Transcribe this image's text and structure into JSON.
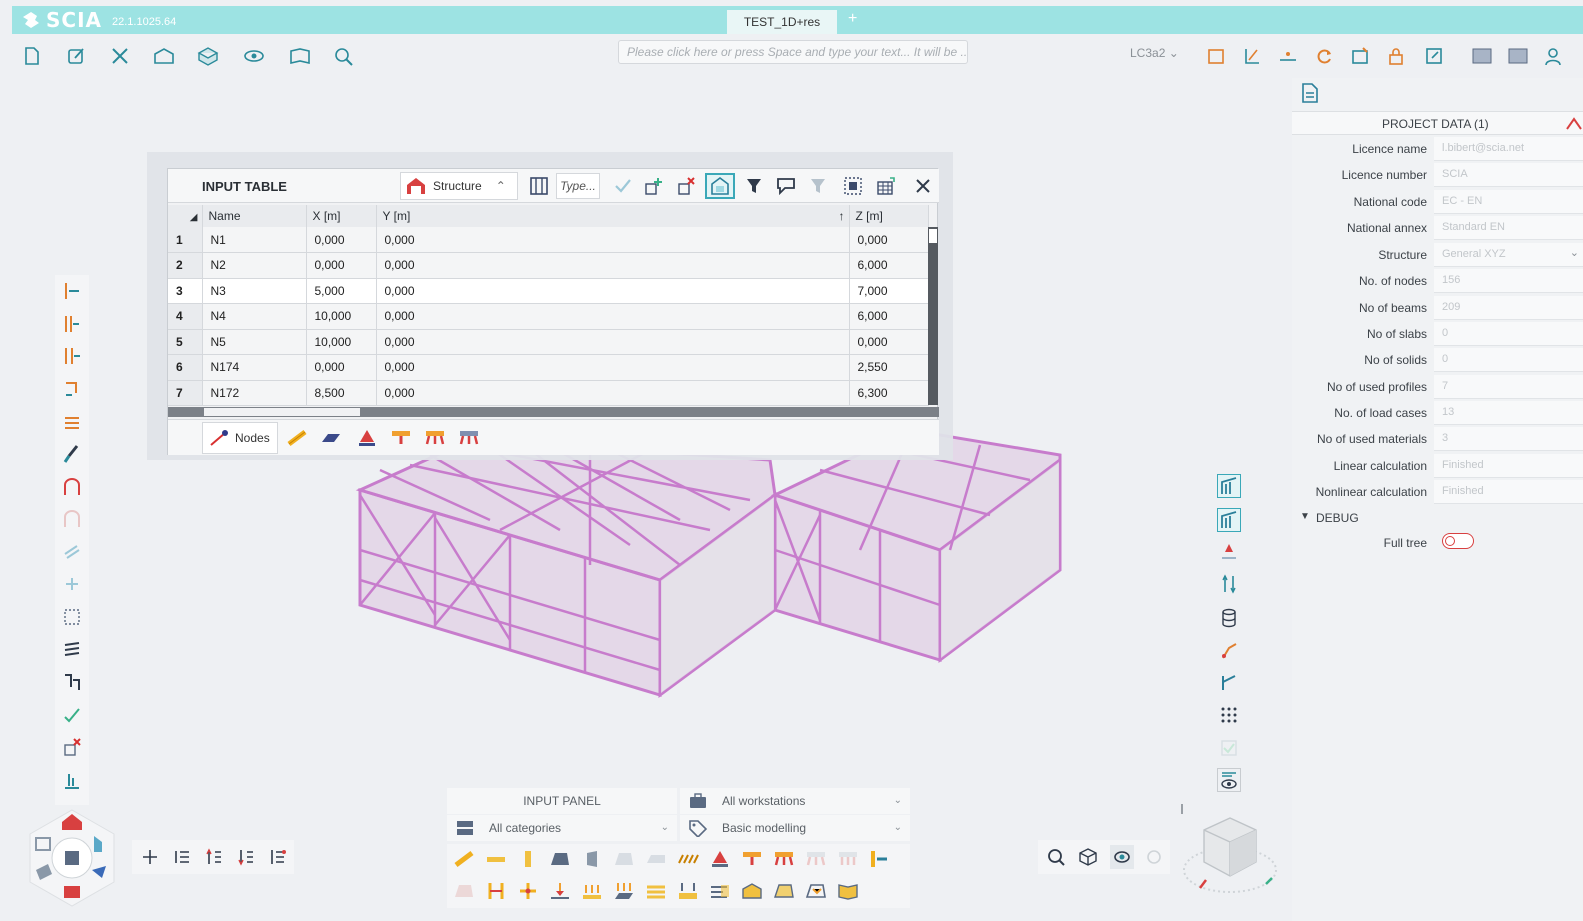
{
  "app": {
    "brand": "SCIA",
    "version": "22.1.1025.64",
    "document_tab": "TEST_1D+res",
    "add_tab": "+"
  },
  "toolbar": {
    "command_placeholder": "Please click here or press Space and type your text... It will be ...",
    "load_case": "LC3a2"
  },
  "input_table": {
    "title": "INPUT TABLE",
    "structure_label": "Structure",
    "type_label": "Type...",
    "columns": [
      "Name",
      "X [m]",
      "Y [m]",
      "Z [m]"
    ],
    "rows": [
      {
        "n": "1",
        "name": "N1",
        "x": "0,000",
        "y": "0,000",
        "z": "0,000"
      },
      {
        "n": "2",
        "name": "N2",
        "x": "0,000",
        "y": "0,000",
        "z": "6,000"
      },
      {
        "n": "3",
        "name": "N3",
        "x": "5,000",
        "y": "0,000",
        "z": "7,000"
      },
      {
        "n": "4",
        "name": "N4",
        "x": "10,000",
        "y": "0,000",
        "z": "6,000"
      },
      {
        "n": "5",
        "name": "N5",
        "x": "10,000",
        "y": "0,000",
        "z": "0,000"
      },
      {
        "n": "6",
        "name": "N174",
        "x": "0,000",
        "y": "0,000",
        "z": "2,550"
      },
      {
        "n": "7",
        "name": "N172",
        "x": "8,500",
        "y": "0,000",
        "z": "6,300"
      }
    ],
    "footer_tab": "Nodes"
  },
  "project_data": {
    "title": "PROJECT DATA (1)",
    "fields": [
      {
        "label": "Licence name",
        "value": "l.bibert@scia.net"
      },
      {
        "label": "Licence number",
        "value": "SCIA"
      },
      {
        "label": "National code",
        "value": "EC - EN"
      },
      {
        "label": "National annex",
        "value": "Standard EN"
      },
      {
        "label": "Structure",
        "value": "General XYZ"
      },
      {
        "label": "No. of nodes",
        "value": "156"
      },
      {
        "label": "No of beams",
        "value": "209"
      },
      {
        "label": "No of slabs",
        "value": "0"
      },
      {
        "label": "No of solids",
        "value": "0"
      },
      {
        "label": "No of used profiles",
        "value": "7"
      },
      {
        "label": "No. of load cases",
        "value": "13"
      },
      {
        "label": "No of used materials",
        "value": "3"
      },
      {
        "label": "Linear calculation",
        "value": "Finished"
      },
      {
        "label": "Nonlinear calculation",
        "value": "Finished"
      }
    ],
    "debug_label": "DEBUG",
    "full_tree_label": "Full tree"
  },
  "input_panel": {
    "title": "INPUT PANEL",
    "workstation": "All workstations",
    "category": "All categories",
    "mode": "Basic modelling"
  },
  "colors": {
    "titlebar": "#9de3e3",
    "accent": "#3aa8b8",
    "structure": "#c77ccc"
  }
}
